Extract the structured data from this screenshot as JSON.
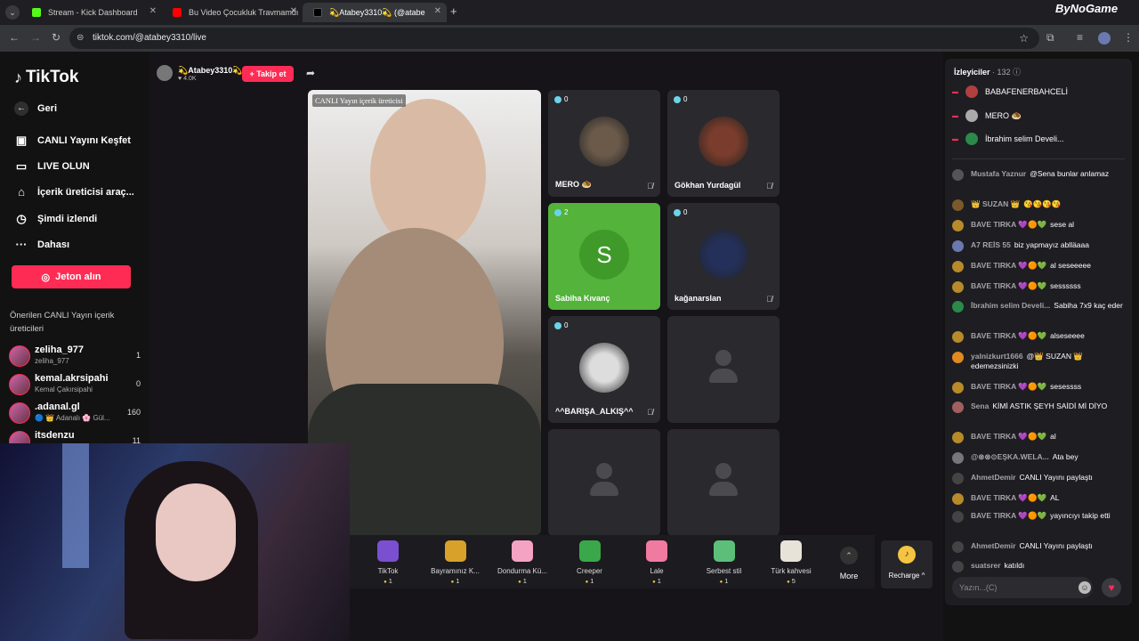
{
  "browser": {
    "tabs": [
      {
        "label": "Stream - Kick Dashboard",
        "color": "#53fc18"
      },
      {
        "label": "Bu Video Çocukluk Travmamdı",
        "color": "#ff0000"
      },
      {
        "label": "💫Atabey3310💫 (@atabe",
        "color": "#000000"
      }
    ],
    "url": "tiktok.com/@atabey3310/live",
    "watermark": "ByNoGame"
  },
  "sidebar": {
    "logo": "TikTok",
    "items": [
      {
        "label": "Geri",
        "icon": "back-arrow-icon",
        "glyph": "←"
      },
      {
        "label": "CANLI Yayını Keşfet",
        "icon": "live-explore-icon",
        "glyph": "▣"
      },
      {
        "label": "LIVE OLUN",
        "icon": "camera-icon",
        "glyph": "▭"
      },
      {
        "label": "İçerik üreticisi araç...",
        "icon": "creator-tools-icon",
        "glyph": "⌂"
      },
      {
        "label": "Şimdi izlendi",
        "icon": "history-icon",
        "glyph": "◷"
      },
      {
        "label": "Dahası",
        "icon": "more-dots-icon",
        "glyph": "···"
      }
    ],
    "coins_button": "Jeton alın",
    "recommended_title": "Önerilen CANLI Yayın içerik üreticileri",
    "recommended": [
      {
        "name": "zeliha_977",
        "sub": "zeliha_977",
        "count": "1"
      },
      {
        "name": "kemal.akrsipahi",
        "sub": "Kemal Çakırsipahi",
        "count": "0"
      },
      {
        "name": ".adanal.gl",
        "sub": "🔵 👑 Adanalı 🌸 Gül...",
        "count": "160"
      },
      {
        "name": "itsdenzu",
        "sub": "",
        "count": "11"
      }
    ]
  },
  "stream": {
    "host_name": "💫Atabey3310💫",
    "host_likes": "♥ 4.0K",
    "follow_label": "+ Takip et",
    "main_label": "CANLI Yayın içerik üreticisi",
    "guests": [
      {
        "count": "0",
        "name": "MERO 🧆",
        "muted": true,
        "kind": "photo",
        "color": "#6b5a4a"
      },
      {
        "count": "0",
        "name": "Gökhan Yurdagül",
        "muted": true,
        "kind": "photo",
        "color": "#7a3c2c"
      },
      {
        "count": "2",
        "name": "Sabiha Kıvanç",
        "muted": false,
        "kind": "letter",
        "letter": "S"
      },
      {
        "count": "0",
        "name": "kağanarslan",
        "muted": true,
        "kind": "photo",
        "color": "#24305a"
      },
      {
        "count": "0",
        "name": "^^BARIŞA_ALKIŞ^^",
        "muted": true,
        "kind": "photo",
        "color": "#dddddd"
      },
      {
        "count": "",
        "name": "",
        "muted": false,
        "kind": "empty"
      },
      {
        "count": "",
        "name": "",
        "muted": false,
        "kind": "empty"
      },
      {
        "count": "",
        "name": "",
        "muted": false,
        "kind": "empty"
      }
    ],
    "gifts": [
      {
        "name": "TikTok",
        "price": "1",
        "color": "#7a4fd0"
      },
      {
        "name": "Bayramınız K...",
        "price": "1",
        "color": "#d8a12a"
      },
      {
        "name": "Dondurma Kü...",
        "price": "1",
        "color": "#f4a3c2"
      },
      {
        "name": "Creeper",
        "price": "1",
        "color": "#3aa84a"
      },
      {
        "name": "Lale",
        "price": "1",
        "color": "#f07aa0"
      },
      {
        "name": "Serbest stil",
        "price": "1",
        "color": "#5bbf7a"
      },
      {
        "name": "Türk kahvesi",
        "price": "5",
        "color": "#e8e3d8"
      }
    ],
    "more_label": "More",
    "recharge_label": "Recharge ^"
  },
  "chat": {
    "viewers_title": "İzleyiciler",
    "viewers_count": "· 132",
    "top_viewers": [
      "BABAFENERBAHCELİ",
      "MERO 🧆",
      "İbrahim selim Develi..."
    ],
    "messages": [
      {
        "user": "Mustafa Yaznur",
        "text": "@Sena bunlar anlamaz"
      },
      {
        "user": "👑 SUZAN 👑",
        "text": "😘😘😘😘"
      },
      {
        "user": "BAVE TIRKA 💜🟠💚",
        "text": "sese al"
      },
      {
        "user": "A7 REİS 55",
        "text": "biz yapmayız ablläaaa"
      },
      {
        "user": "BAVE TIRKA 💜🟠💚",
        "text": "al seseeeee"
      },
      {
        "user": "BAVE TIRKA 💜🟠💚",
        "text": "sessssss"
      },
      {
        "user": "İbrahim selim Develi...",
        "text": "Sabiha 7x9 kaç eder"
      },
      {
        "user": "BAVE TIRKA 💜🟠💚",
        "text": "alseseeee"
      },
      {
        "user": "yalnizkurt1666",
        "text": "@👑 SUZAN 👑 edemezsinizki"
      },
      {
        "user": "BAVE TIRKA 💜🟠💚",
        "text": "sesessss"
      },
      {
        "user": "Sena",
        "text": "KİMİ ASTIK ŞEYH SAİDİ Mİ DİYO"
      },
      {
        "user": "BAVE TIRKA 💜🟠💚",
        "text": "al"
      },
      {
        "user": "@⊗⊗⊙EŞKA.WELA...",
        "text": "Ata bey"
      },
      {
        "user": "AhmetDemir",
        "text": "CANLI Yayını paylaştı"
      },
      {
        "user": "BAVE TIRKA 💜🟠💚",
        "text": "AL"
      },
      {
        "user": "BAVE TIRKA 💜🟠💚",
        "text": "yayıncıyı takip etti"
      },
      {
        "user": "AhmetDemir",
        "text": "CANLI Yayını paylaştı"
      },
      {
        "user": "suatsrer",
        "text": "katıldı"
      }
    ],
    "input_placeholder": "Yazın...(C)"
  }
}
